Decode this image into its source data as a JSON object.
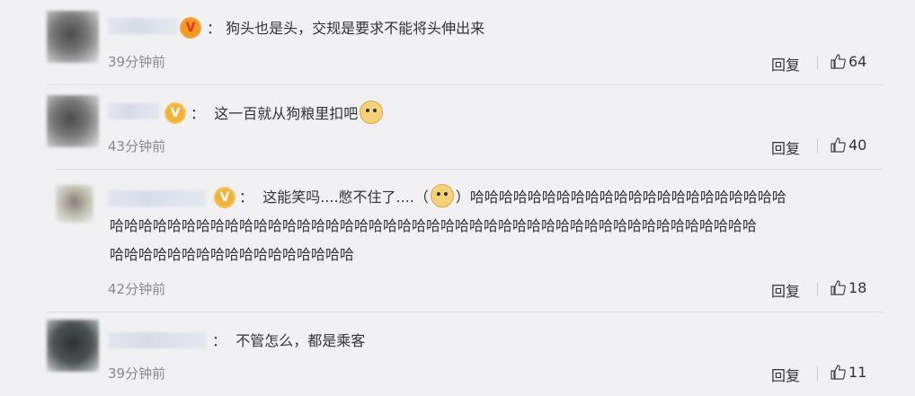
{
  "comments": [
    {
      "badge": "V",
      "badge_color": "#e8342c",
      "text": "狗头也是头，交规是要求不能将头伸出来",
      "time": "39分钟前",
      "reply": "回复",
      "likes": "64"
    },
    {
      "badge": "V",
      "badge_color": "#f2b23a",
      "text": "这一百就从狗粮里扣吧",
      "time": "43分钟前",
      "reply": "回复",
      "likes": "40"
    },
    {
      "badge": "V",
      "badge_color": "#f2b23a",
      "text_a": "这能笑吗....憋不住了....（",
      "text_b": "）哈哈哈哈哈哈哈哈哈哈哈哈哈哈哈哈哈哈哈哈哈哈",
      "line2": "哈哈哈哈哈哈哈哈哈哈哈哈哈哈哈哈哈哈哈哈哈哈哈哈哈哈哈哈哈哈哈哈哈哈哈哈哈哈哈哈哈哈哈哈哈",
      "line3": "哈哈哈哈哈哈哈哈哈哈哈哈哈哈哈哈哈",
      "time": "42分钟前",
      "reply": "回复",
      "likes": "18"
    },
    {
      "text": "不管怎么，都是乘客",
      "time": "39分钟前",
      "reply": "回复",
      "likes": "11"
    }
  ],
  "colon": "：",
  "icons": {
    "like": "thumbs-up-icon",
    "verified": "verified-v-icon",
    "emoji": "doge-emoji-icon"
  }
}
